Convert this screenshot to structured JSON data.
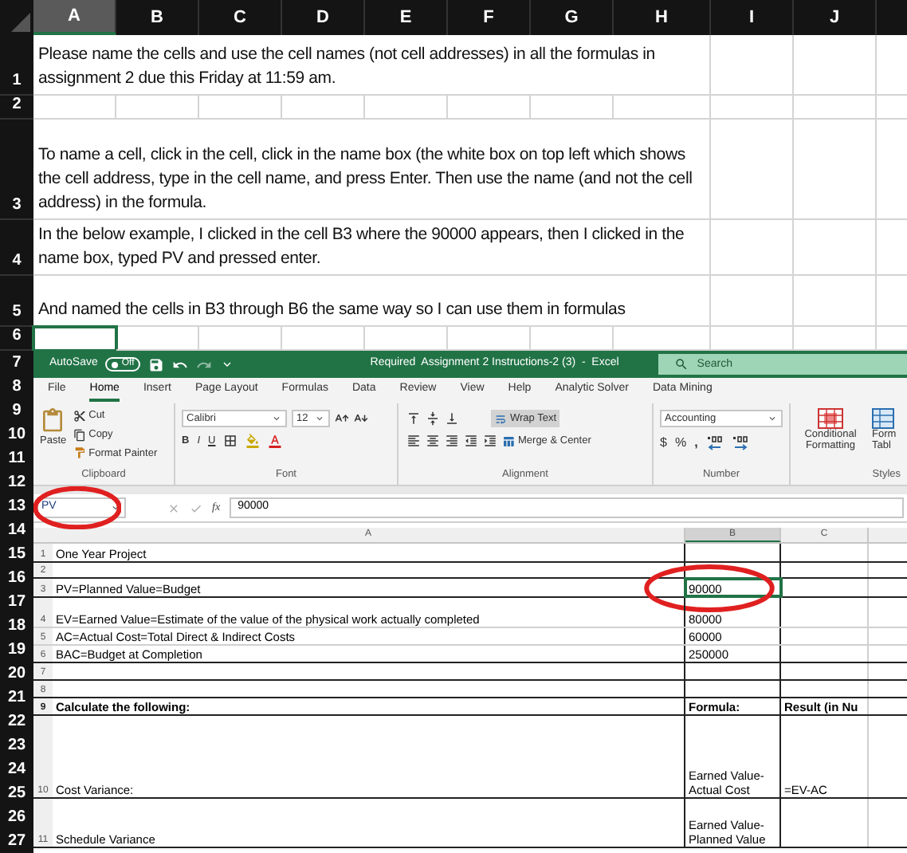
{
  "column_headers": [
    {
      "label": "A",
      "selected": true
    },
    {
      "label": "B",
      "selected": false
    },
    {
      "label": "C",
      "selected": false
    },
    {
      "label": "D",
      "selected": false
    },
    {
      "label": "E",
      "selected": false
    },
    {
      "label": "F",
      "selected": false
    },
    {
      "label": "G",
      "selected": false
    },
    {
      "label": "H",
      "selected": false
    },
    {
      "label": "I",
      "selected": false
    },
    {
      "label": "J",
      "selected": false
    }
  ],
  "top_rows": [
    {
      "header": "1",
      "text": "Please name the cells and use the cell names (not cell addresses) in all the formulas in assignment 2 due this Friday at 11:59 am.",
      "active": false
    },
    {
      "header": "2",
      "active": false
    },
    {
      "header": "3",
      "text": "To name a cell, click in the cell, click in the name box (the white box on top left which shows the cell address, type in the cell name, and press Enter.  Then use the name (and not the cell address) in the formula.",
      "active": false
    },
    {
      "header": "4",
      "text": "In the below example, I clicked in the cell B3 where the 90000 appears, then I clicked in the name box, typed PV and pressed enter.",
      "active": false
    },
    {
      "header": "5",
      "text": "And named the cells in B3 through B6 the same way so I can use them in formulas",
      "active": false
    },
    {
      "header": "6",
      "active": true
    }
  ],
  "side_row_headers": [
    "7",
    "8",
    "9",
    "10",
    "11",
    "12",
    "13",
    "14",
    "15",
    "16",
    "17",
    "18",
    "19",
    "20",
    "21",
    "22",
    "23",
    "24",
    "25",
    "26",
    "27"
  ],
  "excel": {
    "title_bar": {
      "autosave_label": "AutoSave",
      "autosave_toggle": {
        "label": "Off",
        "on": false
      },
      "title": "Required  Assignment 2 Instructions-2 (3)  -  Excel",
      "search_placeholder": "Search"
    },
    "menu_tabs": [
      {
        "label": "File",
        "selected": false
      },
      {
        "label": "Home",
        "selected": true
      },
      {
        "label": "Insert",
        "selected": false
      },
      {
        "label": "Page Layout",
        "selected": false
      },
      {
        "label": "Formulas",
        "selected": false
      },
      {
        "label": "Data",
        "selected": false
      },
      {
        "label": "Review",
        "selected": false
      },
      {
        "label": "View",
        "selected": false
      },
      {
        "label": "Help",
        "selected": false
      },
      {
        "label": "Analytic Solver",
        "selected": false
      },
      {
        "label": "Data Mining",
        "selected": false
      }
    ],
    "ribbon": {
      "clipboard": {
        "paste": "Paste",
        "cut": "Cut",
        "copy": "Copy",
        "format_painter": "Format Painter",
        "label": "Clipboard"
      },
      "font": {
        "name": "Calibri",
        "size": "12",
        "bold": "B",
        "italic": "I",
        "underline": "U",
        "label": "Font"
      },
      "alignment": {
        "wrap_text": {
          "label": "Wrap Text",
          "on": true
        },
        "merge_center": "Merge & Center",
        "label": "Alignment"
      },
      "number": {
        "format": "Accounting",
        "currency": "$",
        "percent": "%",
        "comma": ",",
        "label": "Number"
      },
      "styles": {
        "conditional_formatting": "Conditional Formatting",
        "format_as_table_1": "Form",
        "format_as_table_2": "Tabl",
        "label": "Styles"
      }
    },
    "formula_bar": {
      "name_box": "PV",
      "circled": true,
      "function_label": "fx",
      "value": "90000"
    },
    "sheet": {
      "columns": [
        {
          "label": "A",
          "selected": false
        },
        {
          "label": "B",
          "selected": true
        },
        {
          "label": "C",
          "selected": false
        }
      ],
      "rows": [
        {
          "number": "1",
          "bold": false,
          "cells": [
            {
              "text": "One Year Project",
              "selected": false,
              "circled": false
            },
            {
              "selected": false,
              "circled": false
            },
            {
              "selected": false,
              "circled": false
            }
          ]
        },
        {
          "number": "2",
          "bold": false,
          "cells": [
            {
              "selected": false,
              "circled": false
            },
            {
              "selected": false,
              "circled": false
            },
            {
              "selected": false,
              "circled": false
            }
          ]
        },
        {
          "number": "3",
          "bold": false,
          "cells": [
            {
              "text": "PV=Planned Value=Budget",
              "selected": false,
              "circled": false
            },
            {
              "text": "90000",
              "selected": true,
              "circled": true
            },
            {
              "selected": false,
              "circled": false
            }
          ]
        },
        {
          "number": "4",
          "bold": false,
          "cells": [
            {
              "text": "EV=Earned Value=Estimate of the value of the physical work actually completed",
              "selected": false,
              "circled": false
            },
            {
              "text": "80000",
              "selected": false,
              "circled": false
            },
            {
              "selected": false,
              "circled": false
            }
          ]
        },
        {
          "number": "5",
          "bold": false,
          "cells": [
            {
              "text": "AC=Actual Cost=Total Direct & Indirect Costs",
              "selected": false,
              "circled": false
            },
            {
              "text": "60000",
              "selected": false,
              "circled": false
            },
            {
              "selected": false,
              "circled": false
            }
          ]
        },
        {
          "number": "6",
          "bold": false,
          "cells": [
            {
              "text": "BAC=Budget at Completion",
              "selected": false,
              "circled": false
            },
            {
              "text": "250000",
              "selected": false,
              "circled": false
            },
            {
              "selected": false,
              "circled": false
            }
          ]
        },
        {
          "number": "7",
          "bold": false,
          "cells": [
            {
              "selected": false,
              "circled": false
            },
            {
              "selected": false,
              "circled": false
            },
            {
              "selected": false,
              "circled": false
            }
          ]
        },
        {
          "number": "8",
          "bold": false,
          "cells": [
            {
              "selected": false,
              "circled": false
            },
            {
              "selected": false,
              "circled": false
            },
            {
              "selected": false,
              "circled": false
            }
          ]
        },
        {
          "number": "9",
          "bold": true,
          "cells": [
            {
              "text": "Calculate the following:",
              "selected": false,
              "circled": false
            },
            {
              "text": "Formula:",
              "selected": false,
              "circled": false
            },
            {
              "text": "Result (in Nu",
              "selected": false,
              "circled": false
            }
          ]
        },
        {
          "number": "10",
          "bold": false,
          "cells": [
            {
              "text": "Cost Variance:",
              "selected": false,
              "circled": false
            },
            {
              "text": "Earned Value-Actual Cost",
              "selected": false,
              "circled": false
            },
            {
              "text": "=EV-AC",
              "selected": false,
              "circled": false
            }
          ]
        },
        {
          "number": "11",
          "bold": false,
          "cells": [
            {
              "text": "Schedule Variance",
              "selected": false,
              "circled": false
            },
            {
              "text": "Earned Value-Planned Value",
              "selected": false,
              "circled": false
            },
            {
              "selected": false,
              "circled": false
            }
          ]
        }
      ]
    }
  }
}
